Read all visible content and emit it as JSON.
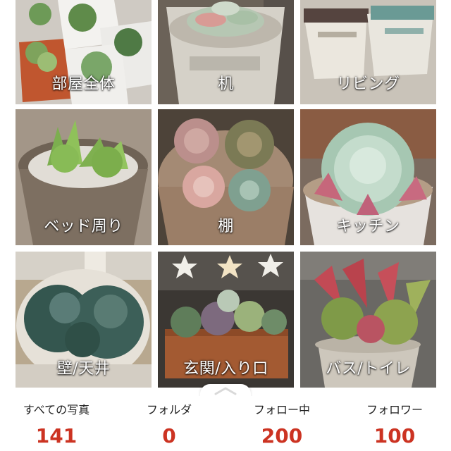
{
  "categories": [
    {
      "label": "部屋全体"
    },
    {
      "label": "机"
    },
    {
      "label": "リビング"
    },
    {
      "label": "ベッド周り"
    },
    {
      "label": "棚"
    },
    {
      "label": "キッチン"
    },
    {
      "label": "壁/天井"
    },
    {
      "label": "玄関/入り口"
    },
    {
      "label": "バス/トイレ"
    }
  ],
  "stats": [
    {
      "label": "すべての写真",
      "value": "141"
    },
    {
      "label": "フォルダ",
      "value": "0"
    },
    {
      "label": "フォロー中",
      "value": "200"
    },
    {
      "label": "フォロワー",
      "value": "100"
    }
  ],
  "colors": {
    "accent": "#cc3322",
    "label_text": "#ffffff",
    "stat_label": "#222222"
  },
  "icons": {
    "drawer_handle": "chevron-up-icon"
  }
}
